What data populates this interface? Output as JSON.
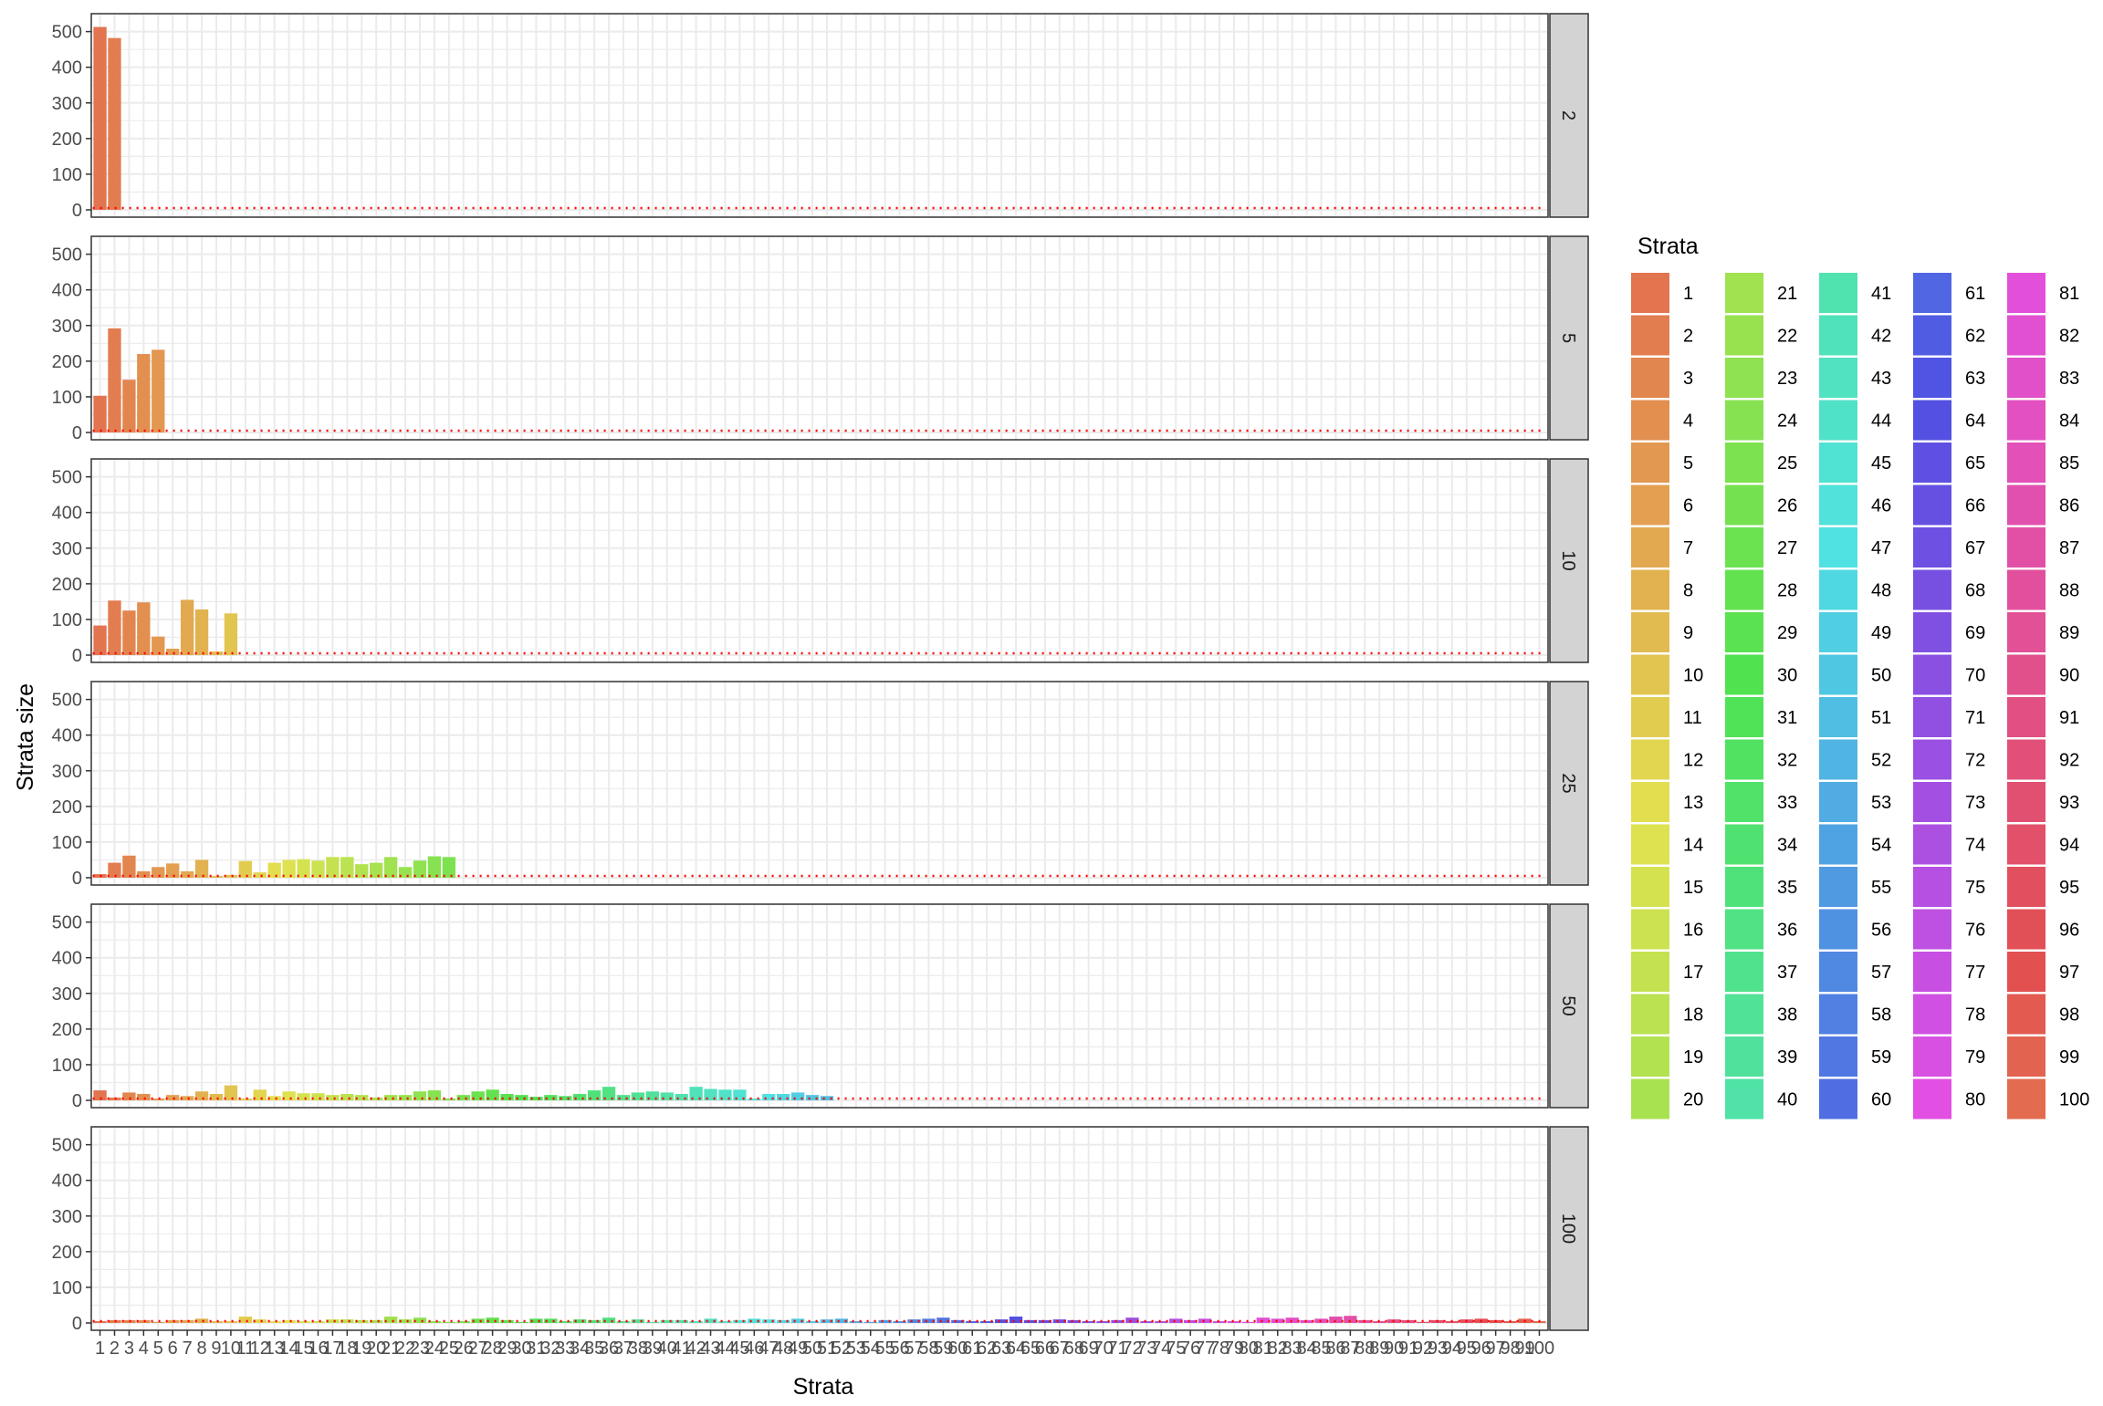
{
  "chart_data": {
    "type": "bar",
    "facet_by": "number of strata",
    "panels": [
      {
        "label": "2",
        "values": [
          513,
          482
        ]
      },
      {
        "label": "5",
        "values": [
          103,
          292,
          148,
          220,
          232
        ]
      },
      {
        "label": "10",
        "values": [
          83,
          153,
          125,
          148,
          52,
          18,
          155,
          128,
          10,
          117
        ]
      },
      {
        "label": "25",
        "values": [
          10,
          42,
          62,
          18,
          30,
          40,
          18,
          50,
          5,
          8,
          47,
          15,
          42,
          50,
          52,
          48,
          58,
          58,
          38,
          42,
          58,
          30,
          48,
          60,
          58
        ]
      },
      {
        "label": "50",
        "values": [
          28,
          8,
          22,
          18,
          5,
          15,
          12,
          25,
          18,
          42,
          5,
          30,
          12,
          25,
          20,
          20,
          15,
          18,
          15,
          8,
          15,
          15,
          25,
          28,
          5,
          15,
          25,
          30,
          18,
          15,
          10,
          15,
          12,
          18,
          28,
          38,
          15,
          22,
          25,
          22,
          18,
          38,
          32,
          30,
          30,
          5,
          18,
          18,
          22,
          15,
          12
        ]
      },
      {
        "label": "100",
        "values": [
          5,
          8,
          8,
          8,
          3,
          8,
          8,
          12,
          5,
          5,
          18,
          10,
          5,
          8,
          5,
          5,
          10,
          10,
          8,
          8,
          18,
          10,
          15,
          5,
          3,
          5,
          12,
          15,
          8,
          3,
          12,
          12,
          5,
          10,
          8,
          15,
          5,
          10,
          3,
          8,
          8,
          5,
          12,
          5,
          8,
          12,
          10,
          8,
          12,
          5,
          10,
          12,
          5,
          3,
          8,
          5,
          10,
          12,
          15,
          8,
          5,
          5,
          10,
          18,
          8,
          8,
          10,
          8,
          5,
          5,
          8,
          15,
          5,
          5,
          12,
          8,
          12,
          5,
          5,
          3,
          15,
          12,
          15,
          8,
          12,
          18,
          20,
          8,
          5,
          10,
          8,
          3,
          8,
          5,
          10,
          12,
          8,
          5,
          12,
          5
        ]
      }
    ],
    "categories": [
      "1",
      "2",
      "3",
      "4",
      "5",
      "6",
      "7",
      "8",
      "9",
      "10",
      "11",
      "12",
      "13",
      "14",
      "15",
      "16",
      "17",
      "18",
      "19",
      "20",
      "21",
      "22",
      "23",
      "24",
      "25",
      "26",
      "27",
      "28",
      "29",
      "30",
      "31",
      "32",
      "33",
      "34",
      "35",
      "36",
      "37",
      "38",
      "39",
      "40",
      "41",
      "42",
      "43",
      "44",
      "45",
      "46",
      "47",
      "48",
      "49",
      "50",
      "51",
      "52",
      "53",
      "54",
      "55",
      "56",
      "57",
      "58",
      "59",
      "60",
      "61",
      "62",
      "63",
      "64",
      "65",
      "66",
      "67",
      "68",
      "69",
      "70",
      "71",
      "72",
      "73",
      "74",
      "75",
      "76",
      "77",
      "78",
      "79",
      "80",
      "81",
      "82",
      "83",
      "84",
      "85",
      "86",
      "87",
      "88",
      "89",
      "90",
      "91",
      "92",
      "93",
      "94",
      "95",
      "96",
      "97",
      "98",
      "99",
      "100"
    ],
    "y_ticks": [
      "0",
      "100",
      "200",
      "300",
      "400",
      "500"
    ],
    "ylim": [
      0,
      540
    ],
    "xlabel": "Strata",
    "ylabel": "Strata size",
    "legend_title": "Strata",
    "legend_position": "right",
    "reference_line": {
      "y": 5,
      "style": "dotted",
      "color": "#FF0000"
    },
    "grid": true,
    "panel_border_color": "#333333",
    "strip_fill": "#D3D3D3",
    "grid_color": "#EBEBEB"
  }
}
